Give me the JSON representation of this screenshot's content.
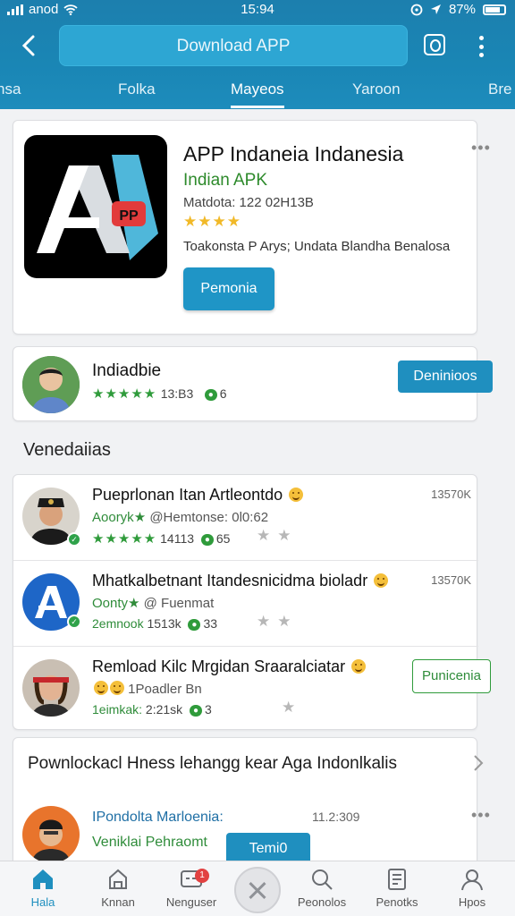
{
  "status_bar": {
    "carrier": "anod",
    "time": "15:94",
    "battery": "87%"
  },
  "header": {
    "download_label": "Download APP",
    "tabs": [
      "nsa",
      "Folka",
      "Mayeos",
      "Yaroon",
      "Bre"
    ],
    "active_tab_index": 2
  },
  "app_card": {
    "title": "APP Indaneia Indanesia",
    "subtitle": "Indian APK",
    "meta": "Matdota: 122 02H13B",
    "stars": "★★★★",
    "description": "Toakonsta P Arys; Undata Blandha Benalosa",
    "primary_button": "Pemonia",
    "logo_text": "A"
  },
  "developer_card": {
    "name": "Indiadbie",
    "stars": "★★★★★",
    "rating_text": "13:B3",
    "count": "6",
    "button": "Deninioos"
  },
  "section_title": "Venedaiias",
  "list": [
    {
      "title": "Pueprlonan Itan Artleontdo",
      "handle_brand": "Aooryk",
      "handle_rest": "@Hemtonse: 0l0:62",
      "stars": "★★★★★",
      "rating": "14113",
      "count": "65",
      "time": "13570K"
    },
    {
      "title": "Mhatkalbetnant Itandesnicidma bioladr",
      "handle_brand": "Oonty",
      "handle_rest": "@ Fuenmat",
      "meta_prefix": "2emnook",
      "rating": "1513k",
      "count": "33",
      "time": "13570K"
    },
    {
      "title": "Remload Kilc Mrgidan Sraaralciatar",
      "handle_rest": "1Poadler Bn",
      "meta_prefix": "1eimkak:",
      "rating": "2:21sk",
      "count": "3",
      "button": "Punicenia"
    }
  ],
  "promo_card": {
    "title": "Pownlockacl Hness lehangg kear Aga Indonlkalis",
    "item_name": "IPondolta Marloenia:",
    "item_sub": "Veniklai Pehraomt",
    "item_time": "11.2:309",
    "button": "Temi0"
  },
  "bottom_nav": [
    {
      "label": "Hala",
      "icon": "home-icon"
    },
    {
      "label": "Knnan",
      "icon": "store-icon"
    },
    {
      "label": "Nenguser",
      "icon": "chat-icon",
      "badge": "1"
    },
    {
      "label": "",
      "icon": "close-icon"
    },
    {
      "label": "Peonolos",
      "icon": "search-icon"
    },
    {
      "label": "Penotks",
      "icon": "notes-icon"
    },
    {
      "label": "Hpos",
      "icon": "profile-icon"
    }
  ],
  "colors": {
    "header_blue": "#1a86b5",
    "accent_blue": "#1f95c6",
    "green": "#2f9b3b",
    "star_gold": "#f1b928"
  }
}
